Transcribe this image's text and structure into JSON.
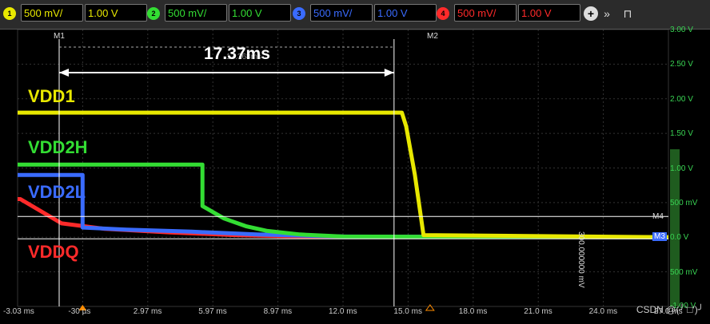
{
  "toolbar": {
    "channels": [
      {
        "num": "1",
        "scale": "500 mV/",
        "offset": "1.00 V",
        "color": "#e8e800"
      },
      {
        "num": "2",
        "scale": "500 mV/",
        "offset": "1.00 V",
        "color": "#33dd33"
      },
      {
        "num": "3",
        "scale": "500 mV/",
        "offset": "1.00 V",
        "color": "#3a6bff"
      },
      {
        "num": "4",
        "scale": "500 mV/",
        "offset": "1.00 V",
        "color": "#ff2a2a"
      }
    ],
    "add_icon": "plus-circle-icon",
    "expand_icon": "double-chevron-right-icon",
    "pin_icon": "pin-icon"
  },
  "markers": {
    "m1": "M1",
    "m2": "M2",
    "m3": "M3",
    "m4": "M4"
  },
  "measurement": {
    "delta_label": "17.37ms",
    "overlay_text": "17.368ms"
  },
  "cursor_readout": "300.000000 mV",
  "channel_labels": {
    "vdd1": "VDD1",
    "vdd2h": "VDD2H",
    "vdd2l": "VDD2L",
    "vddq": "VDDQ"
  },
  "x_ticks": [
    "-3.03 ms",
    "-30 µs",
    "2.97 ms",
    "5.97 ms",
    "8.97 ms",
    "12.0 ms",
    "15.0 ms",
    "18.0 ms",
    "21.0 ms",
    "24.0 ms",
    "27.0 ms"
  ],
  "y_ticks": [
    "3.00 V",
    "2.50 V",
    "2.00 V",
    "1.50 V",
    "1.00 V",
    "500 mV",
    "0.0 V",
    "500 mV",
    "-1.00 V"
  ],
  "watermark": "CSDN @(╯‵□′)╯",
  "chart_data": {
    "type": "line",
    "x_unit": "ms",
    "y_unit": "V",
    "xlim": [
      -3.03,
      27.0
    ],
    "ylim": [
      -1.0,
      3.0
    ],
    "grid": true,
    "series": [
      {
        "name": "VDD1",
        "color": "#e8e800",
        "x": [
          -3.03,
          14.7,
          14.9,
          15.3,
          15.7,
          27.0
        ],
        "y": [
          1.8,
          1.8,
          1.6,
          0.9,
          0.03,
          0.0
        ]
      },
      {
        "name": "VDD2H",
        "color": "#33dd33",
        "x": [
          -3.03,
          5.5,
          5.5,
          6.5,
          7.5,
          8.5,
          10.0,
          12.0,
          27.0
        ],
        "y": [
          1.05,
          1.05,
          0.45,
          0.27,
          0.16,
          0.09,
          0.04,
          0.01,
          0.0
        ]
      },
      {
        "name": "VDD2L",
        "color": "#3a6bff",
        "x": [
          -3.03,
          -0.03,
          -0.03,
          2.0,
          5.0,
          8.0,
          12.0,
          27.0
        ],
        "y": [
          0.9,
          0.9,
          0.14,
          0.11,
          0.08,
          0.04,
          0.01,
          0.0
        ]
      },
      {
        "name": "VDDQ",
        "color": "#ff2a2a",
        "x": [
          -3.03,
          -3.0,
          -3.0,
          -2.9,
          -1.0,
          1.0,
          4.0,
          7.0,
          10.0,
          27.0
        ],
        "y": [
          0.55,
          0.55,
          0.55,
          0.55,
          0.2,
          0.12,
          0.07,
          0.03,
          0.01,
          0.0
        ]
      }
    ],
    "cursors": {
      "m1_x": -3.03,
      "m2_x": 14.34,
      "m3_y": 0.0,
      "m4_y": 0.3
    }
  }
}
